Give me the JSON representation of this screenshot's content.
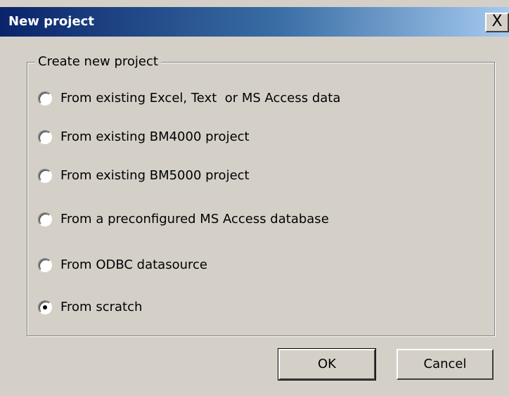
{
  "window": {
    "title": "New project",
    "close_glyph": "X"
  },
  "group": {
    "label": "Create new project"
  },
  "options": [
    {
      "label": "From existing Excel, Text  or MS Access data",
      "selected": false
    },
    {
      "label": "From existing BM4000 project",
      "selected": false
    },
    {
      "label": "From existing BM5000 project",
      "selected": false
    },
    {
      "label": "From a preconfigured MS Access database",
      "selected": false
    },
    {
      "label": "From ODBC datasource",
      "selected": false
    },
    {
      "label": "From scratch",
      "selected": true
    }
  ],
  "buttons": {
    "ok_label": "OK",
    "cancel_label": "Cancel"
  },
  "colors": {
    "titlebar_start": "#0a246a",
    "titlebar_end": "#a6caf0",
    "dialog_background": "#d4d0c8"
  },
  "icons": {
    "close": "close-icon"
  }
}
